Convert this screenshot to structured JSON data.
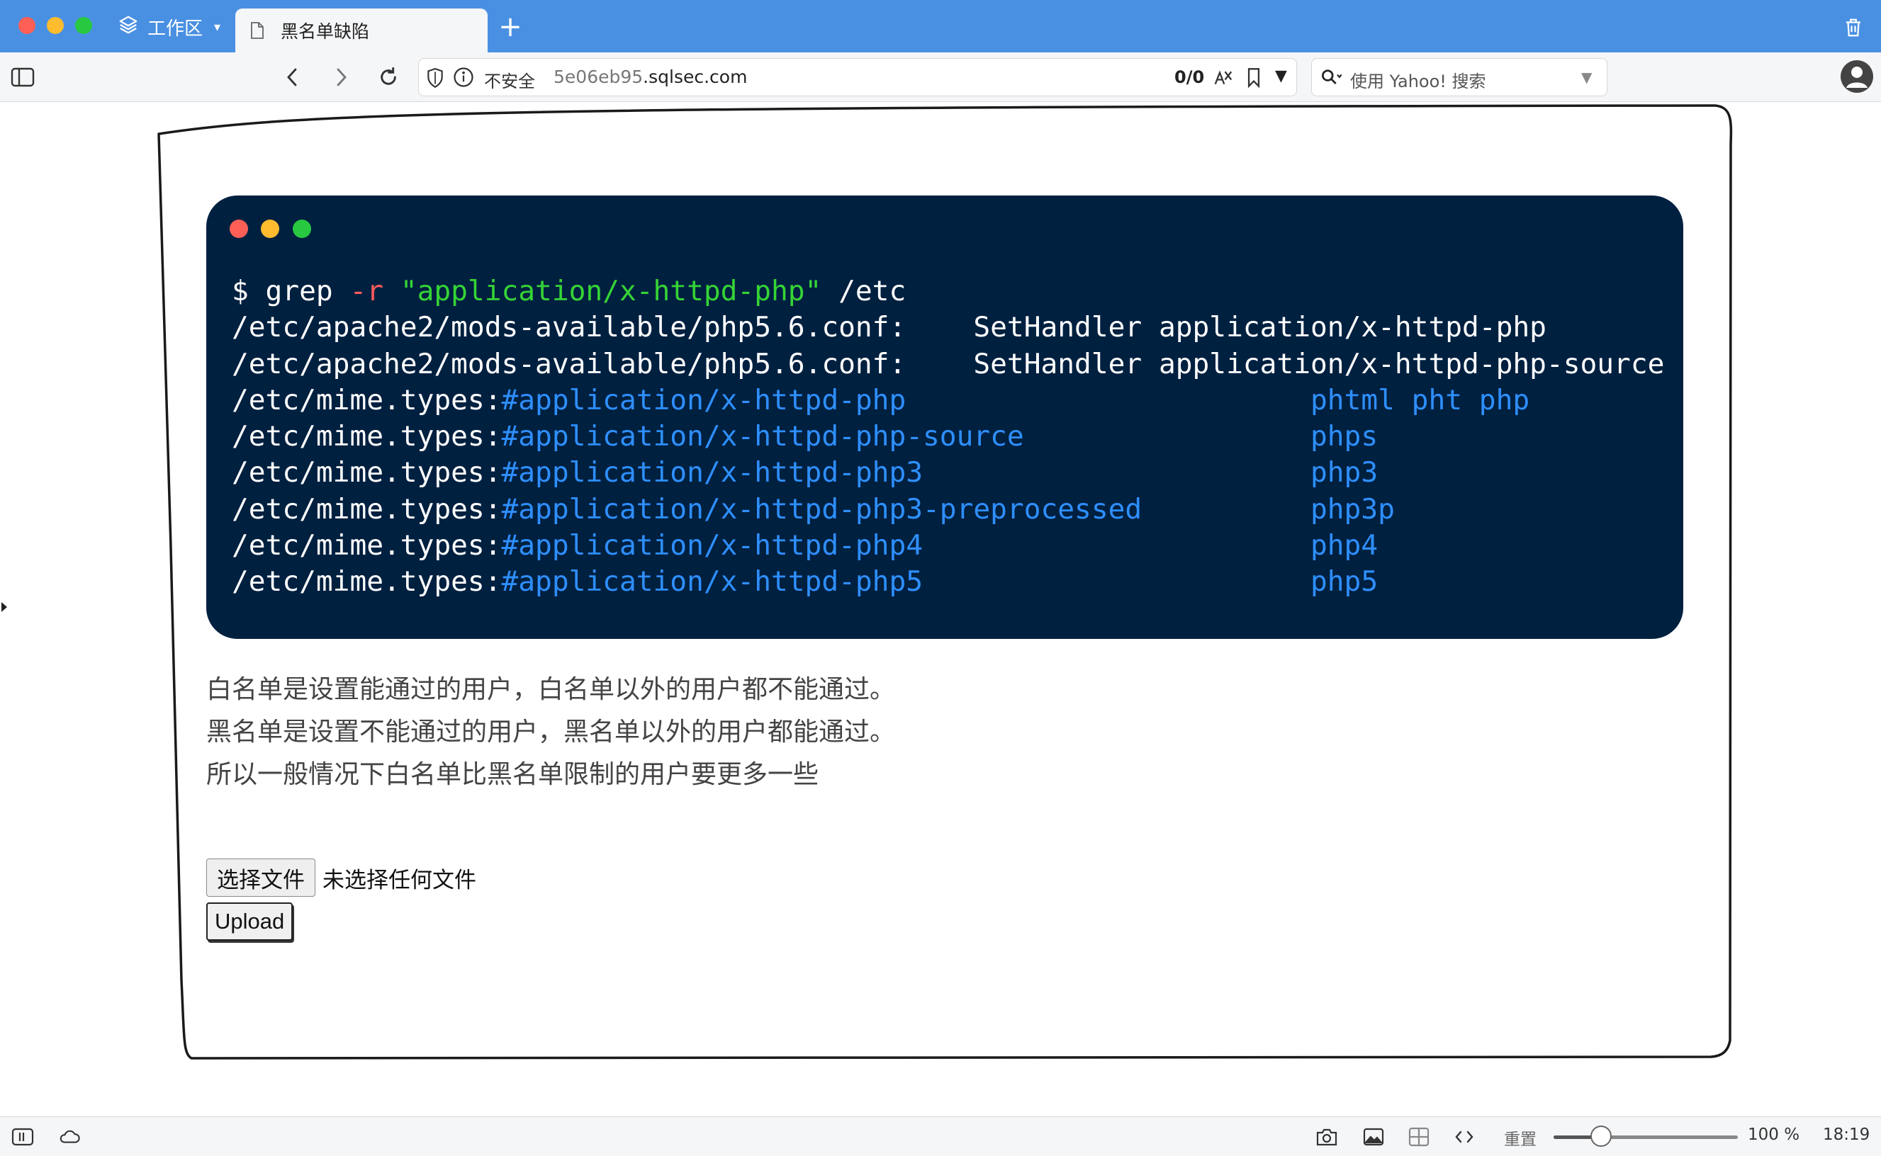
{
  "tabbar": {
    "workspace_label": "工作区",
    "active_tab_title": "黑名单缺陷",
    "new_tab_symbol": "+"
  },
  "address": {
    "insecure_label": "不安全",
    "url_subdomain": "5e06eb95",
    "url_domain": ".sqlsec.com",
    "match_count": "0/0",
    "search_placeholder": "使用 Yahoo! 搜索"
  },
  "terminal": {
    "lines": [
      [
        {
          "t": "$ grep ",
          "c": "w"
        },
        {
          "t": "-r",
          "c": "r"
        },
        {
          "t": " ",
          "c": "w"
        },
        {
          "t": "\"application/x-httpd-php\"",
          "c": "g"
        },
        {
          "t": " /etc",
          "c": "w"
        }
      ],
      [
        {
          "t": "/etc/apache2/mods-available/php5.6.conf:    SetHandler application/x-httpd-php",
          "c": "w"
        }
      ],
      [
        {
          "t": "/etc/apache2/mods-available/php5.6.conf:    SetHandler application/x-httpd-php-source",
          "c": "w"
        }
      ],
      [
        {
          "t": "/etc/mime.types:",
          "c": "w"
        },
        {
          "t": "#application/x-httpd-php                        phtml pht php",
          "c": "b"
        }
      ],
      [
        {
          "t": "/etc/mime.types:",
          "c": "w"
        },
        {
          "t": "#application/x-httpd-php-source                 phps",
          "c": "b"
        }
      ],
      [
        {
          "t": "/etc/mime.types:",
          "c": "w"
        },
        {
          "t": "#application/x-httpd-php3                       php3",
          "c": "b"
        }
      ],
      [
        {
          "t": "/etc/mime.types:",
          "c": "w"
        },
        {
          "t": "#application/x-httpd-php3-preprocessed          php3p",
          "c": "b"
        }
      ],
      [
        {
          "t": "/etc/mime.types:",
          "c": "w"
        },
        {
          "t": "#application/x-httpd-php4                       php4",
          "c": "b"
        }
      ],
      [
        {
          "t": "/etc/mime.types:",
          "c": "w"
        },
        {
          "t": "#application/x-httpd-php5                       php5",
          "c": "b"
        }
      ]
    ]
  },
  "description": {
    "line1": "白名单是设置能通过的用户，白名单以外的用户都不能通过。",
    "line2": "黑名单是设置不能通过的用户，黑名单以外的用户都能通过。",
    "line3": "所以一般情况下白名单比黑名单限制的用户要更多一些"
  },
  "form": {
    "choose_file_label": "选择文件",
    "no_file_text": "未选择任何文件",
    "upload_label": "Upload"
  },
  "statusbar": {
    "reset_label": "重置",
    "zoom_value": 100,
    "zoom_label": "100 %",
    "clock": "18:19"
  },
  "colors": {
    "tabbar": "#4a90e2",
    "terminal_bg": "#002040",
    "code_white": "#ffffff",
    "code_red": "#ff5c5c",
    "code_green": "#35d435",
    "code_blue": "#2e8fff"
  }
}
